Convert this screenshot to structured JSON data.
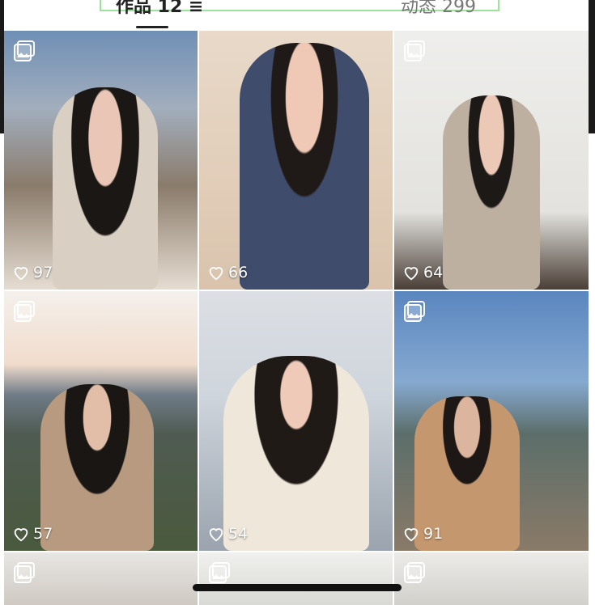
{
  "tabs": {
    "works": "作品 12 ≡",
    "posts": "动态 299"
  },
  "posts": [
    {
      "likes": "97",
      "icon": "gallery-icon"
    },
    {
      "likes": "66",
      "icon": ""
    },
    {
      "likes": "64",
      "icon": "gallery-icon"
    },
    {
      "likes": "57",
      "icon": "gallery-icon"
    },
    {
      "likes": "54",
      "icon": ""
    },
    {
      "likes": "91",
      "icon": "gallery-icon"
    },
    {
      "likes": "",
      "icon": "gallery-icon"
    },
    {
      "likes": "",
      "icon": "gallery-icon"
    },
    {
      "likes": "",
      "icon": "gallery-icon"
    }
  ],
  "colors": {
    "like_text": "#ffffff",
    "tab_active": "#222222",
    "tab_inactive": "#777777"
  }
}
